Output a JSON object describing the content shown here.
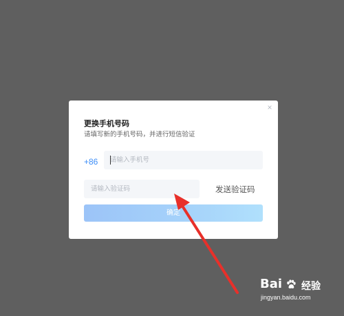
{
  "dialog": {
    "close_glyph": "×",
    "title": "更换手机号码",
    "subtitle": "请填写新的手机号码，并进行短信验证",
    "country_code": "+86",
    "phone_placeholder": "请输入手机号",
    "code_placeholder": "请输入验证码",
    "send_code_label": "发送验证码",
    "confirm_label": "确定"
  },
  "colors": {
    "accent": "#3e8ef7",
    "button_gradient_start": "#9cc4f8",
    "button_gradient_end": "#b0e0fc",
    "arrow": "#e8302a",
    "overlay": "#5f5f5f"
  },
  "watermark": {
    "logo_part1": "Bai",
    "logo_part2": "经验",
    "url": "jingyan.baidu.com"
  }
}
